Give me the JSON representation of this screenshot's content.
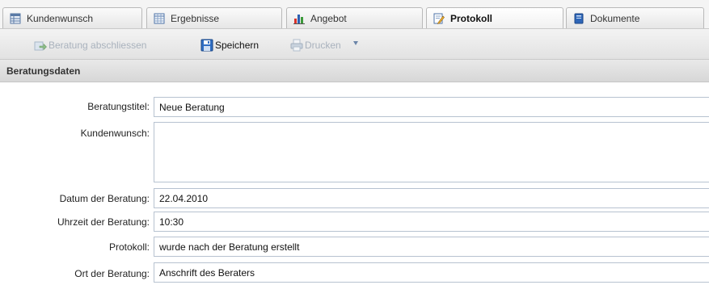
{
  "tabs": [
    {
      "label": "Kundenwunsch",
      "icon": "table-icon",
      "active": false
    },
    {
      "label": "Ergebnisse",
      "icon": "spreadsheet-icon",
      "active": false
    },
    {
      "label": "Angebot",
      "icon": "bar-chart-icon",
      "active": false
    },
    {
      "label": "Protokoll",
      "icon": "edit-document-icon",
      "active": true
    },
    {
      "label": "Dokumente",
      "icon": "document-icon",
      "active": false
    }
  ],
  "toolbar": {
    "finish_label": "Beratung abschliessen",
    "finish_icon": "export-arrow-icon",
    "save_label": "Speichern",
    "save_icon": "floppy-disk-icon",
    "print_label": "Drucken",
    "print_icon": "printer-icon",
    "print_menu_icon": "dropdown-arrow-icon"
  },
  "section": {
    "title": "Beratungsdaten"
  },
  "form": {
    "title_label": "Beratungstitel:",
    "title_value": "Neue Beratung",
    "wish_label": "Kundenwunsch:",
    "wish_value": "",
    "date_label": "Datum der Beratung:",
    "date_value": "22.04.2010",
    "time_label": "Uhrzeit der Beratung:",
    "time_value": "10:30",
    "protocol_label": "Protokoll:",
    "protocol_value": "wurde nach der Beratung erstellt",
    "place_label": "Ort der Beratung:",
    "place_value": "Anschrift des Beraters"
  },
  "colors": {
    "disabled_text": "#a9b2bd",
    "input_border": "#b7c2d0",
    "tab_border": "#b9b9b9"
  }
}
